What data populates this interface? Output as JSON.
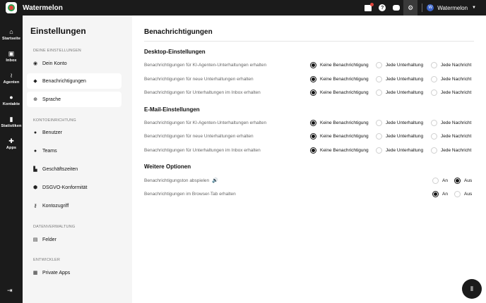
{
  "app": {
    "title": "Watermelon"
  },
  "topbar": {
    "workspace_name": "Watermelon",
    "workspace_initial": "W"
  },
  "sidebar": {
    "items": [
      {
        "label": "Startseite",
        "icon": "home-icon"
      },
      {
        "label": "Inbox",
        "icon": "inbox-icon"
      },
      {
        "label": "Agenten",
        "icon": "agents-icon"
      },
      {
        "label": "Kontakte",
        "icon": "contacts-icon"
      },
      {
        "label": "Statistiken",
        "icon": "stats-icon"
      },
      {
        "label": "Apps",
        "icon": "apps-icon"
      }
    ]
  },
  "settings_panel": {
    "title": "Einstellungen",
    "sections": {
      "personal": "DEINE EINSTELLUNGEN",
      "account": "KONTOEINRICHTUNG",
      "data": "DATENVERWALTUNG",
      "developer": "ENTWICKLER"
    },
    "items": {
      "account_profile": "Dein Konto",
      "notifications": "Benachrichtigungen",
      "language": "Sprache",
      "users": "Benutzer",
      "teams": "Teams",
      "business_hours": "Geschäftszeiten",
      "gdpr": "DSGVO-Konformität",
      "account_access": "Kontozugriff",
      "fields": "Felder",
      "private_apps": "Private Apps"
    }
  },
  "main": {
    "title": "Benachrichtigungen",
    "desktop": {
      "title": "Desktop-Einstellungen",
      "rows": [
        "Benachrichtigungen für KI-Agenten-Unterhaltungen erhalten",
        "Benachrichtigungen für neue Unterhaltungen erhalten",
        "Benachrichtigungen für Unterhaltungen im Inbox erhalten"
      ]
    },
    "email": {
      "title": "E-Mail-Einstellungen",
      "rows": [
        "Benachrichtigungen für KI-Agenten-Unterhaltungen erhalten",
        "Benachrichtigungen für neue Unterhaltungen erhalten",
        "Benachrichtigungen für Unterhaltungen im Inbox erhalten"
      ]
    },
    "options": [
      "Keine Benachrichtigung",
      "Jede Unterhaltung",
      "Jede Nachricht"
    ],
    "selected_option": "Keine Benachrichtigung",
    "more": {
      "title": "Weitere Optionen",
      "sound_label": "Benachrichtigungston abspielen",
      "sound_selected": "Aus",
      "browser_tab_label": "Benachrichtigungen im Browser-Tab erhalten",
      "browser_tab_selected": "An",
      "on": "An",
      "off": "Aus"
    }
  }
}
